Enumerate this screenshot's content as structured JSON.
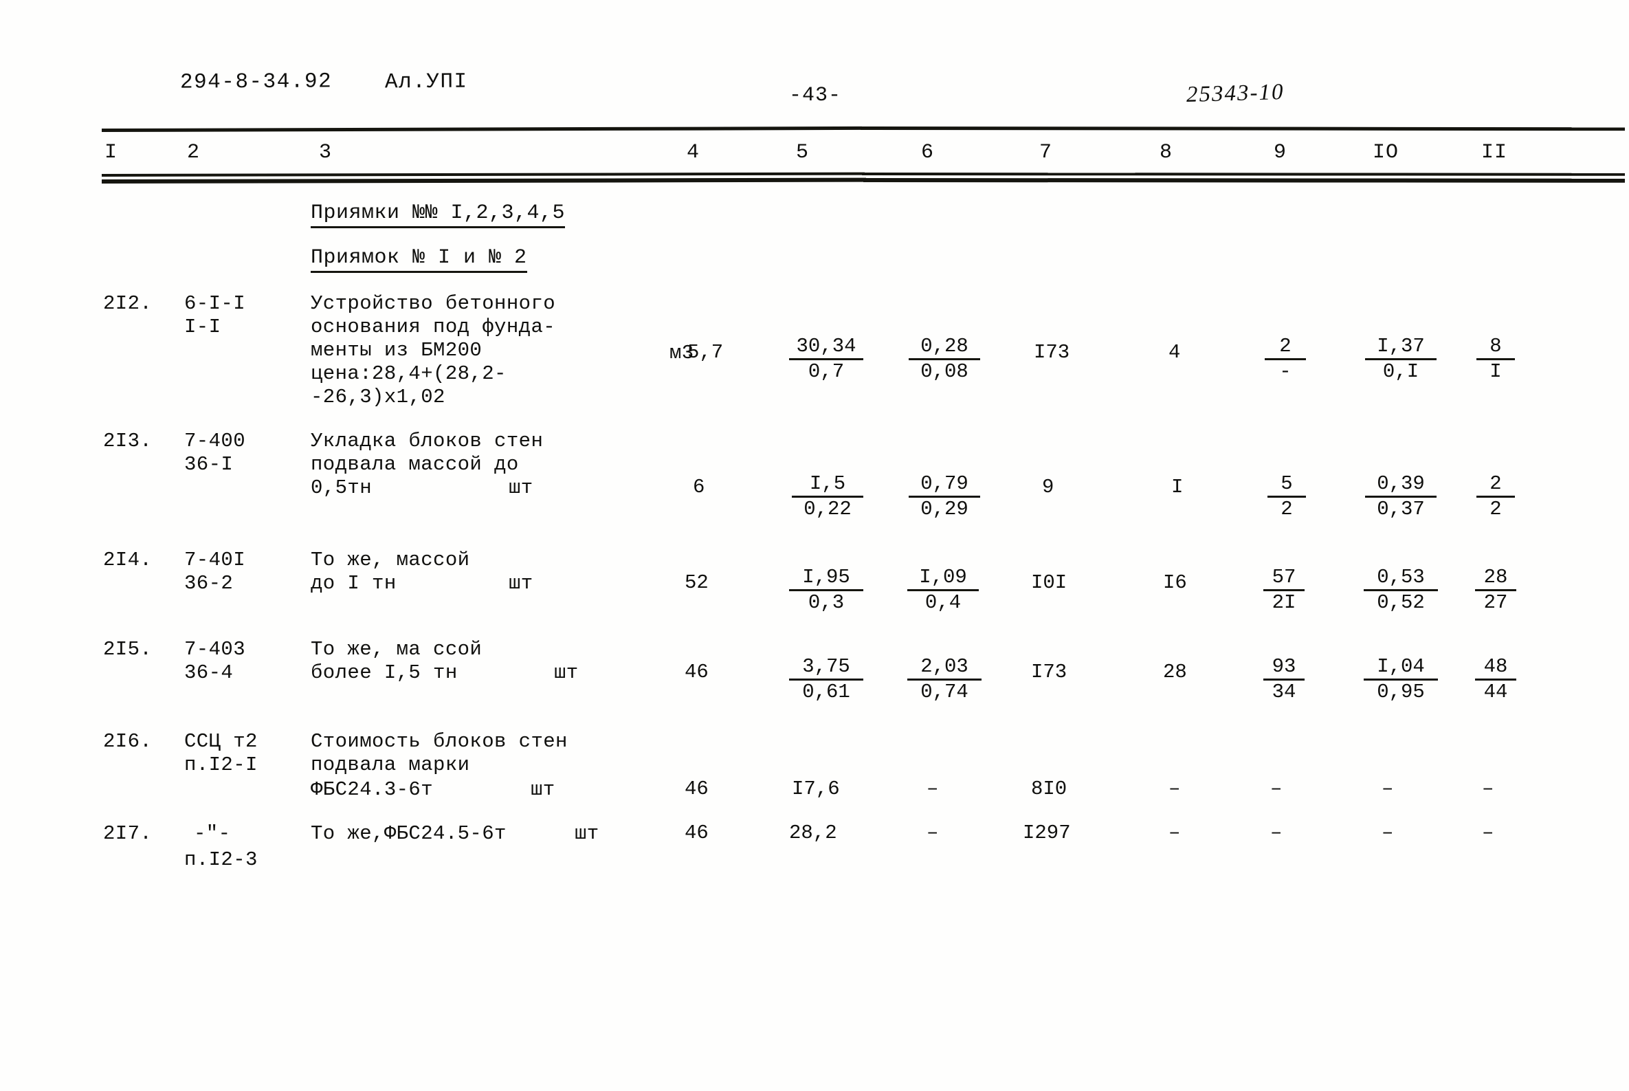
{
  "header": {
    "doc_code": "294-8-34.92",
    "album": "Ал.УПІ",
    "page_number": "-43-",
    "order_number": "25343-10"
  },
  "table": {
    "column_numbers": [
      "I",
      "2",
      "3",
      "4",
      "5",
      "6",
      "7",
      "8",
      "9",
      "IO",
      "II"
    ],
    "sections": [
      {
        "title": "Приямки №№ I,2,3,4,5"
      },
      {
        "title": "Приямок № I и № 2"
      }
    ],
    "rows": [
      {
        "no": "2I2.",
        "code_line1": "6-I-I",
        "code_line2": "I-I",
        "desc_lines": [
          "Устройство бетонного",
          "основания под фунда-",
          "менты из БМ200",
          "цена:28,4+(28,2-",
          "-26,3)х1,02"
        ],
        "unit": "м3",
        "c4": "5,7",
        "c5_top": "30,34",
        "c5_bot": "0,7",
        "c6_top": "0,28",
        "c6_bot": "0,08",
        "c7": "I73",
        "c8": "4",
        "c9_top": "2",
        "c9_bot": "-",
        "c10_top": "I,37",
        "c10_bot": "0,I",
        "c11_top": "8",
        "c11_bot": "I"
      },
      {
        "no": "2I3.",
        "code_line1": "7-400",
        "code_line2": "36-I",
        "desc_lines": [
          "Укладка блоков стен",
          "подвала массой до",
          "0,5тн"
        ],
        "unit": "шт",
        "c4": "6",
        "c5_top": "I,5",
        "c5_bot": "0,22",
        "c6_top": "0,79",
        "c6_bot": "0,29",
        "c7": "9",
        "c8": "I",
        "c9_top": "5",
        "c9_bot": "2",
        "c10_top": "0,39",
        "c10_bot": "0,37",
        "c11_top": "2",
        "c11_bot": "2"
      },
      {
        "no": "2I4.",
        "code_line1": "7-40I",
        "code_line2": "36-2",
        "desc_lines": [
          "То же, массой",
          "до I тн"
        ],
        "unit": "шт",
        "c4": "52",
        "c5_top": "I,95",
        "c5_bot": "0,3",
        "c6_top": "I,09",
        "c6_bot": "0,4",
        "c7": "I0I",
        "c8": "I6",
        "c9_top": "57",
        "c9_bot": "2I",
        "c10_top": "0,53",
        "c10_bot": "0,52",
        "c11_top": "28",
        "c11_bot": "27"
      },
      {
        "no": "2I5.",
        "code_line1": "7-403",
        "code_line2": "36-4",
        "desc_lines": [
          "То же, ма ссой",
          "более I,5 тн"
        ],
        "unit": "шт",
        "c4": "46",
        "c5_top": "3,75",
        "c5_bot": "0,61",
        "c6_top": "2,03",
        "c6_bot": "0,74",
        "c7": "I73",
        "c8": "28",
        "c9_top": "93",
        "c9_bot": "34",
        "c10_top": "I,04",
        "c10_bot": "0,95",
        "c11_top": "48",
        "c11_bot": "44"
      },
      {
        "no": "2I6.",
        "code_line1": "ССЦ т2",
        "code_line2": "п.I2-I",
        "desc_lines": [
          "Стоимость блоков стен",
          "подвала марки",
          "ФБС24.3-6т"
        ],
        "unit": "шт",
        "c4": "46",
        "c5": "I7,6",
        "c6": "–",
        "c7": "8I0",
        "c8": "–",
        "c9": "–",
        "c10": "–",
        "c11": "–"
      },
      {
        "no": "2I7.",
        "code_line1": "-\"-",
        "code_line2": "п.I2-3",
        "desc_lines": [
          "То же,ФБС24.5-6т"
        ],
        "unit": "шт",
        "c4": "46",
        "c5": "28,2",
        "c6": "–",
        "c7": "I297",
        "c8": "–",
        "c9": "–",
        "c10": "–",
        "c11": "–"
      }
    ]
  }
}
